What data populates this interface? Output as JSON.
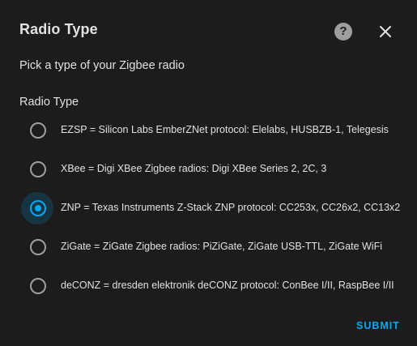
{
  "dialog": {
    "title": "Radio Type",
    "description": "Pick a type of your Zigbee radio",
    "section_label": "Radio Type",
    "help_icon_glyph": "?",
    "options": [
      {
        "label": "EZSP = Silicon Labs EmberZNet protocol: Elelabs, HUSBZB-1, Telegesis",
        "checked": false
      },
      {
        "label": "XBee = Digi XBee Zigbee radios: Digi XBee Series 2, 2C, 3",
        "checked": false
      },
      {
        "label": "ZNP = Texas Instruments Z-Stack ZNP protocol: CC253x, CC26x2, CC13x2",
        "checked": true
      },
      {
        "label": "ZiGate = ZiGate Zigbee radios: PiZiGate, ZiGate USB-TTL, ZiGate WiFi",
        "checked": false
      },
      {
        "label": "deCONZ = dresden elektronik deCONZ protocol: ConBee I/II, RaspBee I/II",
        "checked": false
      }
    ],
    "submit_label": "SUBMIT"
  },
  "colors": {
    "background": "#1c1c1c",
    "text": "#e1e1e1",
    "accent": "#03a9f4",
    "radio_unchecked": "#9e9e9e"
  },
  "icons": {
    "help": "help-circle-icon",
    "close": "close-icon"
  }
}
